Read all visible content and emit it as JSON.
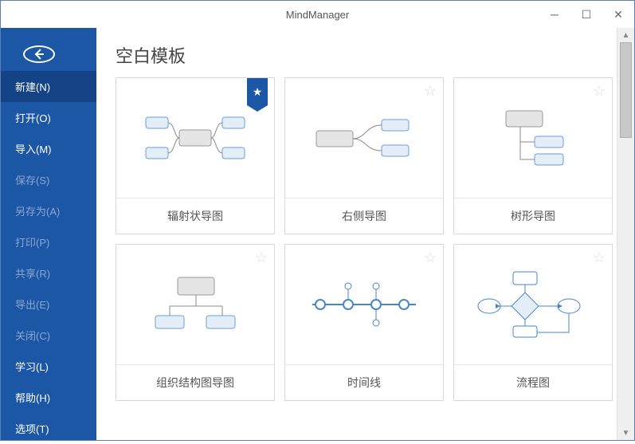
{
  "title": "MindManager",
  "sidebar": {
    "items": [
      {
        "label": "新建(N)",
        "active": true,
        "dimmed": false
      },
      {
        "label": "打开(O)",
        "active": false,
        "dimmed": false
      },
      {
        "label": "导入(M)",
        "active": false,
        "dimmed": false
      },
      {
        "label": "保存(S)",
        "active": false,
        "dimmed": true
      },
      {
        "label": "另存为(A)",
        "active": false,
        "dimmed": true
      },
      {
        "label": "打印(P)",
        "active": false,
        "dimmed": true
      },
      {
        "label": "共享(R)",
        "active": false,
        "dimmed": true
      },
      {
        "label": "导出(E)",
        "active": false,
        "dimmed": true
      },
      {
        "label": "关闭(C)",
        "active": false,
        "dimmed": true
      },
      {
        "label": "学习(L)",
        "active": false,
        "dimmed": false
      },
      {
        "label": "帮助(H)",
        "active": false,
        "dimmed": false
      },
      {
        "label": "选项(T)",
        "active": false,
        "dimmed": false
      }
    ]
  },
  "section_title": "空白模板",
  "templates": [
    {
      "label": "辐射状导图",
      "featured": true
    },
    {
      "label": "右侧导图",
      "featured": false
    },
    {
      "label": "树形导图",
      "featured": false
    },
    {
      "label": "组织结构图导图",
      "featured": false
    },
    {
      "label": "时间线",
      "featured": false
    },
    {
      "label": "流程图",
      "featured": false
    }
  ]
}
